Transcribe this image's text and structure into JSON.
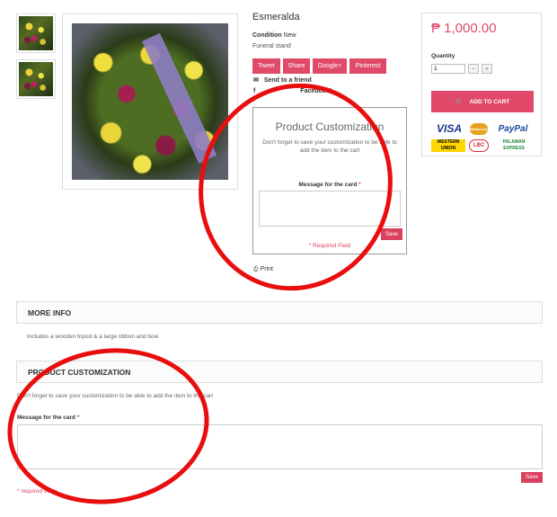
{
  "product": {
    "title": "Esmeralda",
    "condition_label": "Condition",
    "condition_value": "New",
    "short_description": "Funeral stand"
  },
  "share": {
    "tweet": "Tweet",
    "share": "Share",
    "googleplus": "Google+",
    "pinterest": "Pinterest"
  },
  "links": {
    "send_to_friend": "Send to a friend",
    "facebook": "Facebook!",
    "print": "Print"
  },
  "customization_box": {
    "title": "Product Customization",
    "note": "Don't forget to save your customization to be able to add the item to the cart",
    "message_label": "Message for the card",
    "required_mark": "*",
    "save": "Save",
    "required_field": "* Required Field"
  },
  "buy": {
    "price": "₱ 1,000.00",
    "quantity_label": "Quantity",
    "quantity_value": "1",
    "minus": "−",
    "plus": "+",
    "add_to_cart": "ADD TO CART",
    "payment_logos": [
      "VISA",
      "MasterCard",
      "PayPal",
      "WESTERN UNION",
      "LBC",
      "PALAWAN EXPRESS"
    ]
  },
  "more_info": {
    "header": "MORE INFO",
    "text": "Includes a wooden tripod & a large ribbon and bow"
  },
  "product_customization": {
    "header": "PRODUCT CUSTOMIZATION",
    "note": "Don't forget to save your customization to be able to add the item to the cart",
    "message_label": "Message for the card",
    "required_mark": "*",
    "save": "Save",
    "required_field": "* required fields"
  },
  "colors": {
    "accent": "#e04a68",
    "annotation": "#e80e0e"
  }
}
